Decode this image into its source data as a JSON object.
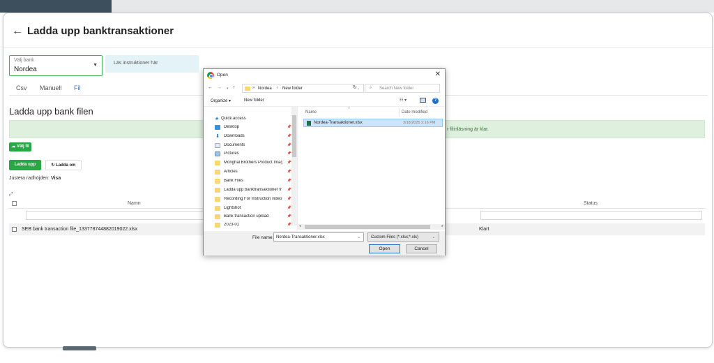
{
  "header": {
    "title": "Ladda upp banktransaktioner"
  },
  "bank_select": {
    "label": "Välj bank",
    "value": "Nordea"
  },
  "instructions": {
    "label": "Läs instruktioner här"
  },
  "tabs": [
    {
      "label": "Csv"
    },
    {
      "label": "Manuell"
    },
    {
      "label": "Fil"
    }
  ],
  "section": {
    "title": "Ladda upp bank filen"
  },
  "info_banner": {
    "text": "r filinläsning är klar."
  },
  "buttons": {
    "valj_fil": "Välj fil",
    "ladda_upp": "Ladda upp",
    "ladda_om": "Ladda om"
  },
  "row_height": {
    "label": "Justera radhöjden:",
    "value": "Visa"
  },
  "table": {
    "columns": [
      "Namn",
      "Status"
    ],
    "rows": [
      {
        "name": "SEB bank transaction file_133778744882019022.xlsx",
        "status": "Klart"
      }
    ]
  },
  "dialog": {
    "title": "Open",
    "address": [
      "Nordea",
      "New folder"
    ],
    "search_placeholder": "Search New folder",
    "toolbar": {
      "organize": "Organize ▾",
      "new_folder": "New folder"
    },
    "quick_access": "Quick access",
    "nav_items": [
      {
        "label": "Desktop"
      },
      {
        "label": "Downloads"
      },
      {
        "label": "Documents"
      },
      {
        "label": "Pictures"
      },
      {
        "label": "Monghal Brothers Product Imaç"
      },
      {
        "label": "Articles"
      },
      {
        "label": "Bank Files"
      },
      {
        "label": "Ladda upp banktransaktioner fr"
      },
      {
        "label": "Recording For Instruction video"
      },
      {
        "label": "Lightshot"
      },
      {
        "label": "Bank transaction upload"
      },
      {
        "label": "2023-01"
      }
    ],
    "columns": {
      "name": "Name",
      "date_modified": "Date modified"
    },
    "file": {
      "name": "Nordea-Transaktioner.xlsx",
      "date": "3/18/2025 2:16 PM"
    },
    "file_name_label": "File name:",
    "file_name_value": "Nordea-Transaktioner.xlsx",
    "file_type": "Custom Files (*.xlsx;*.xls)",
    "open_label": "Open",
    "cancel_label": "Cancel"
  }
}
